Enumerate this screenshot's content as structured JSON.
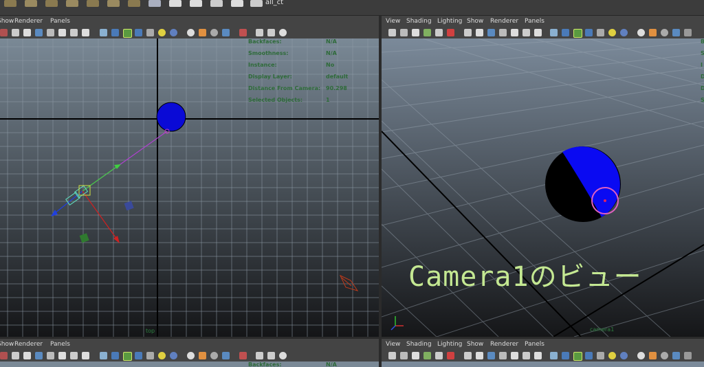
{
  "shelf": {
    "label": "all_ct"
  },
  "panels": {
    "top_left": {
      "menu": [
        "Show",
        "Renderer",
        "Panels"
      ]
    },
    "top_right": {
      "menu": [
        "View",
        "Shading",
        "Lighting",
        "Show",
        "Renderer",
        "Panels"
      ]
    },
    "bottom_left": {
      "menu": [
        "Show",
        "Renderer",
        "Panels"
      ]
    },
    "bottom_right": {
      "menu": [
        "View",
        "Shading",
        "Lighting",
        "Show",
        "Renderer",
        "Panels"
      ]
    }
  },
  "hud": {
    "rows": [
      {
        "label": "Backfaces:",
        "value": "N/A"
      },
      {
        "label": "Smoothness:",
        "value": "N/A"
      },
      {
        "label": "Instance:",
        "value": "No"
      },
      {
        "label": "Display Layer:",
        "value": "default"
      },
      {
        "label": "Distance From Camera:",
        "value": "90.298"
      },
      {
        "label": "Selected Objects:",
        "value": "1"
      }
    ],
    "bottom_row": {
      "label": "Backfaces:",
      "value": "N/A"
    },
    "right_initials": [
      "B",
      "S",
      "I",
      "D",
      "D",
      "S"
    ]
  },
  "viewports": {
    "left_camera": "top",
    "right_camera": "camera1"
  },
  "caption": "Camera1のビュー",
  "colors": {
    "sphere": "#0a0af2",
    "viewport_top": "#7b8a9a",
    "viewport_bottom": "#151618",
    "caption": "#c4e892",
    "hud_text": "#2e6b39"
  }
}
